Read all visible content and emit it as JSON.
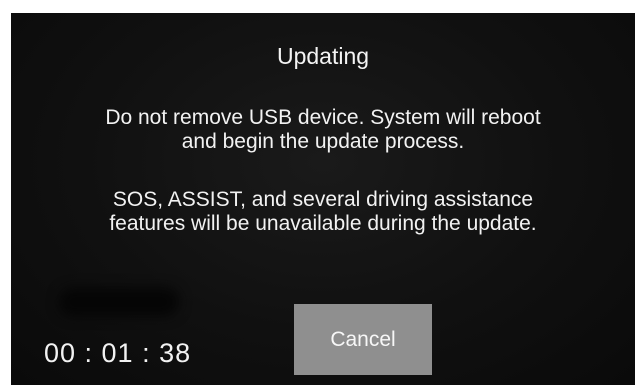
{
  "dialog": {
    "title": "Updating",
    "message_line1a": "Do not remove USB device. System will reboot",
    "message_line1b": "and begin the update process.",
    "message_line2a": "SOS, ASSIST, and several driving assistance",
    "message_line2b": "features will be unavailable during the update.",
    "timer": "00 : 01 : 38",
    "cancel_label": "Cancel"
  },
  "colors": {
    "background": "#101010",
    "text": "#f2f2f2",
    "button": "#8f8f8f"
  }
}
